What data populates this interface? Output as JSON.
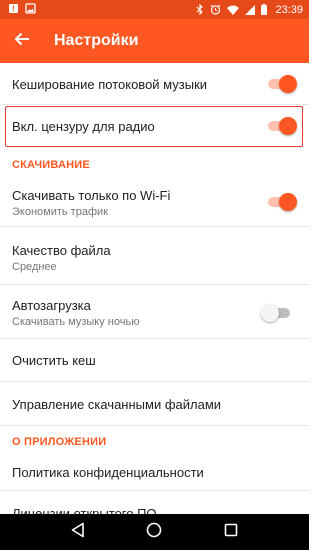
{
  "status_bar": {
    "time": "23:39",
    "left_icons": [
      "notification-icon",
      "image-icon"
    ],
    "right_icons": [
      "bluetooth-icon",
      "alarm-icon",
      "wifi-icon",
      "signal-icon",
      "battery-icon"
    ]
  },
  "app_bar": {
    "title": "Настройки",
    "back_icon": "arrow-back-icon"
  },
  "settings": {
    "cache_streaming": {
      "title": "Кеширование потоковой музыки",
      "enabled": true
    },
    "radio_censor": {
      "title": "Вкл. цензуру для радио",
      "enabled": true,
      "highlighted": true
    },
    "section_download": "СКАЧИВАНИЕ",
    "wifi_only": {
      "title": "Скачивать только по Wi-Fi",
      "subtitle": "Экономить трафик",
      "enabled": true
    },
    "file_quality": {
      "title": "Качество файла",
      "subtitle": "Среднее"
    },
    "autoload": {
      "title": "Автозагрузка",
      "subtitle": "Скачивать музыку ночью",
      "enabled": false
    },
    "clear_cache": {
      "title": "Очистить кеш"
    },
    "manage_downloads": {
      "title": "Управление скачанными файлами"
    },
    "section_about": "О ПРИЛОЖЕНИИ",
    "privacy_policy": {
      "title": "Политика конфиденциальности"
    },
    "open_source": {
      "title": "Лицензии открытого ПО"
    }
  },
  "colors": {
    "accent": "#ff5722",
    "status_bar": "#e64a19",
    "highlight_border": "#e53935"
  },
  "nav_bar": [
    "back-triangle-icon",
    "home-circle-icon",
    "recents-square-icon"
  ]
}
